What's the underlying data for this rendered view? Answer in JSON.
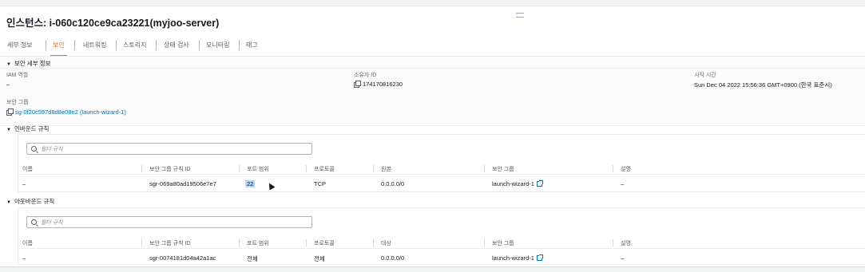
{
  "instance": {
    "title": "인스턴스: i-060c120ce9ca23221(myjoo-server)"
  },
  "tabs": [
    {
      "label": "세부 정보",
      "active": false
    },
    {
      "label": "보안",
      "active": true
    },
    {
      "label": "네트워킹",
      "active": false
    },
    {
      "label": "스토리지",
      "active": false
    },
    {
      "label": "상태 검사",
      "active": false
    },
    {
      "label": "모니터링",
      "active": false
    },
    {
      "label": "태그",
      "active": false
    }
  ],
  "security_details": {
    "section_title": "보안 세부 정보",
    "iam_role_label": "IAM 역할",
    "iam_role_value": "–",
    "owner_id_label": "소유자 ID",
    "owner_id_value": "174170816230",
    "launch_time_label": "시작 시간",
    "launch_time_value": "Sun Dec 04 2022 15:56:36 GMT+0900 (한국 표준시)",
    "security_groups_label": "보안 그룹",
    "security_groups_value": "sg-0f20c597d8d8e08e2 (launch-wizard-1)"
  },
  "inbound": {
    "section_title": "인바운드 규칙",
    "filter_placeholder": "필터 규칙",
    "columns": [
      "이름",
      "보안 그룹 규칙 ID",
      "포트 범위",
      "프로토콜",
      "원본",
      "보안 그룹",
      "설명"
    ],
    "rows": [
      {
        "name": "–",
        "rule_id": "sgr-069a80ad19506e7e7",
        "port_range": "22",
        "protocol": "TCP",
        "source": "0.0.0.0/0",
        "security_group": "launch-wizard-1",
        "description": "–"
      }
    ]
  },
  "outbound": {
    "section_title": "아웃바운드 규칙",
    "filter_placeholder": "필터 규칙",
    "columns": [
      "이름",
      "보안 그룹 규칙 ID",
      "포트 범위",
      "프로토콜",
      "대상",
      "보안 그룹",
      "설명"
    ],
    "rows": [
      {
        "name": "–",
        "rule_id": "sgr-0074181d04a42a1ac",
        "port_range": "전체",
        "protocol": "전체",
        "destination": "0.0.0.0/0",
        "security_group": "launch-wizard-1",
        "description": "–"
      }
    ]
  },
  "colors": {
    "accent": "#ec7211",
    "link": "#0073bb",
    "text": "#16191f",
    "muted": "#687078"
  }
}
